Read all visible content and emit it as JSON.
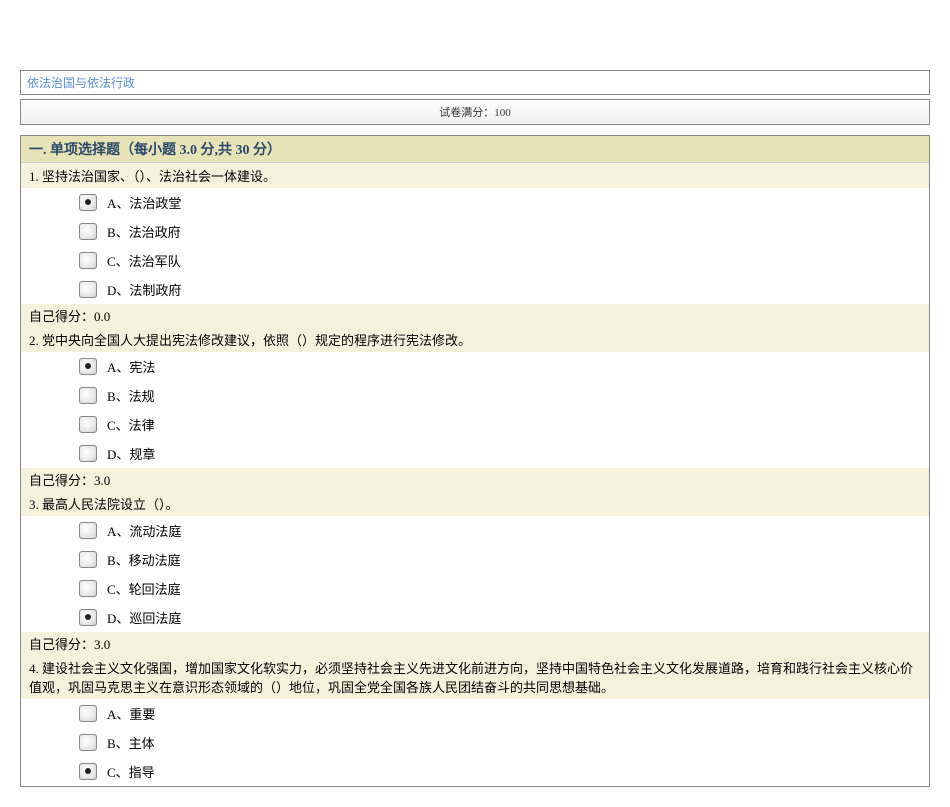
{
  "header": {
    "title_link": "依法治国与依法行政",
    "total_score_label": "试卷满分：100"
  },
  "section": {
    "title": "一. 单项选择题（每小题 3.0 分,共 30 分）"
  },
  "questions": [
    {
      "num": "1.",
      "text": "坚持法治国家、（）、法治社会一体建设。",
      "options": [
        {
          "label": "A、法治政堂",
          "checked": true
        },
        {
          "label": "B、法治政府",
          "checked": false
        },
        {
          "label": "C、法治军队",
          "checked": false
        },
        {
          "label": "D、法制政府",
          "checked": false
        }
      ],
      "score_line": "自己得分：0.0"
    },
    {
      "num": "2.",
      "text": "党中央向全国人大提出宪法修改建议，依照（）规定的程序进行宪法修改。",
      "options": [
        {
          "label": "A、宪法",
          "checked": true
        },
        {
          "label": "B、法规",
          "checked": false
        },
        {
          "label": "C、法律",
          "checked": false
        },
        {
          "label": "D、规章",
          "checked": false
        }
      ],
      "score_line": "自己得分：3.0"
    },
    {
      "num": "3.",
      "text": "最高人民法院设立（）。",
      "options": [
        {
          "label": "A、流动法庭",
          "checked": false
        },
        {
          "label": "B、移动法庭",
          "checked": false
        },
        {
          "label": "C、轮回法庭",
          "checked": false
        },
        {
          "label": "D、巡回法庭",
          "checked": true
        }
      ],
      "score_line": "自己得分：3.0"
    },
    {
      "num": "4.",
      "text": "建设社会主义文化强国，增加国家文化软实力，必须坚持社会主义先进文化前进方向，坚持中国特色社会主义文化发展道路，培育和践行社会主义核心价值观，巩固马克思主义在意识形态领域的（）地位，巩固全党全国各族人民团结奋斗的共同思想基础。",
      "options": [
        {
          "label": "A、重要",
          "checked": false
        },
        {
          "label": "B、主体",
          "checked": false
        },
        {
          "label": "C、指导",
          "checked": true
        }
      ],
      "score_line": ""
    }
  ]
}
